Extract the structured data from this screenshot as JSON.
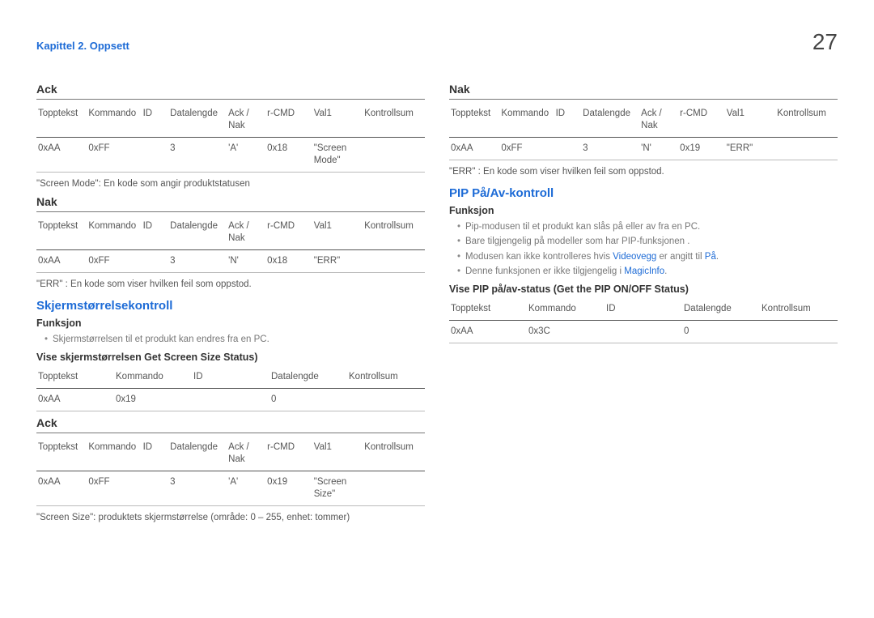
{
  "chapter": "Kapittel 2. Oppsett",
  "pageNumber": "27",
  "table_headers7": [
    "Topptekst",
    "Kommando",
    "ID",
    "Datalengde",
    "Ack / Nak",
    "r-CMD",
    "Val1",
    "Kontrollsum"
  ],
  "table_headers5": [
    "Topptekst",
    "Kommando",
    "ID",
    "Datalengde",
    "Kontrollsum"
  ],
  "left": {
    "ack1_title": "Ack",
    "ack1_row": [
      "0xAA",
      "0xFF",
      "",
      "3",
      "'A'",
      "0x18",
      "\"Screen Mode\"",
      ""
    ],
    "ack1_note": "\"Screen Mode\": En kode som angir produktstatusen",
    "nak1_title": "Nak",
    "nak1_row": [
      "0xAA",
      "0xFF",
      "",
      "3",
      "'N'",
      "0x18",
      "\"ERR\"",
      ""
    ],
    "nak1_note": "\"ERR\" : En kode som viser hvilken feil som oppstod.",
    "screensize_title": "Skjermstørrelsekontroll",
    "funksjon_label": "Funksjon",
    "funksjon_item": "Skjermstørrelsen til et produkt kan endres fra en PC.",
    "vise_title": "Vise skjermstørrelsen Get Screen Size Status)",
    "vise_row": [
      "0xAA",
      "0x19",
      "",
      "0",
      ""
    ],
    "ack2_title": "Ack",
    "ack2_row": [
      "0xAA",
      "0xFF",
      "",
      "3",
      "'A'",
      "0x19",
      "\"Screen Size\"",
      ""
    ],
    "ack2_note": "\"Screen Size\": produktets skjermstørrelse (område: 0 – 255, enhet: tommer)"
  },
  "right": {
    "nak2_title": "Nak",
    "nak2_row": [
      "0xAA",
      "0xFF",
      "",
      "3",
      "'N'",
      "0x19",
      "\"ERR\"",
      ""
    ],
    "nak2_note": "\"ERR\" : En kode som viser hvilken feil som oppstod.",
    "pip_title": "PIP På/Av-kontroll",
    "funksjon_label": "Funksjon",
    "f1": "Pip-modusen til et produkt kan slås på eller av fra en PC.",
    "f2": "Bare tilgjengelig på modeller som har PIP-funksjonen .",
    "f3_a": "Modusen kan ikke kontrolleres hvis ",
    "f3_link": "Videovegg",
    "f3_b": " er angitt til ",
    "f3_link2": "På",
    "f3_c": ".",
    "f4_a": "Denne funksjonen er ikke tilgjengelig i ",
    "f4_link": "MagicInfo",
    "f4_b": ".",
    "vise_pip_title": "Vise PIP på/av-status (Get the PIP ON/OFF Status)",
    "vise_pip_row": [
      "0xAA",
      "0x3C",
      "",
      "0",
      ""
    ]
  }
}
